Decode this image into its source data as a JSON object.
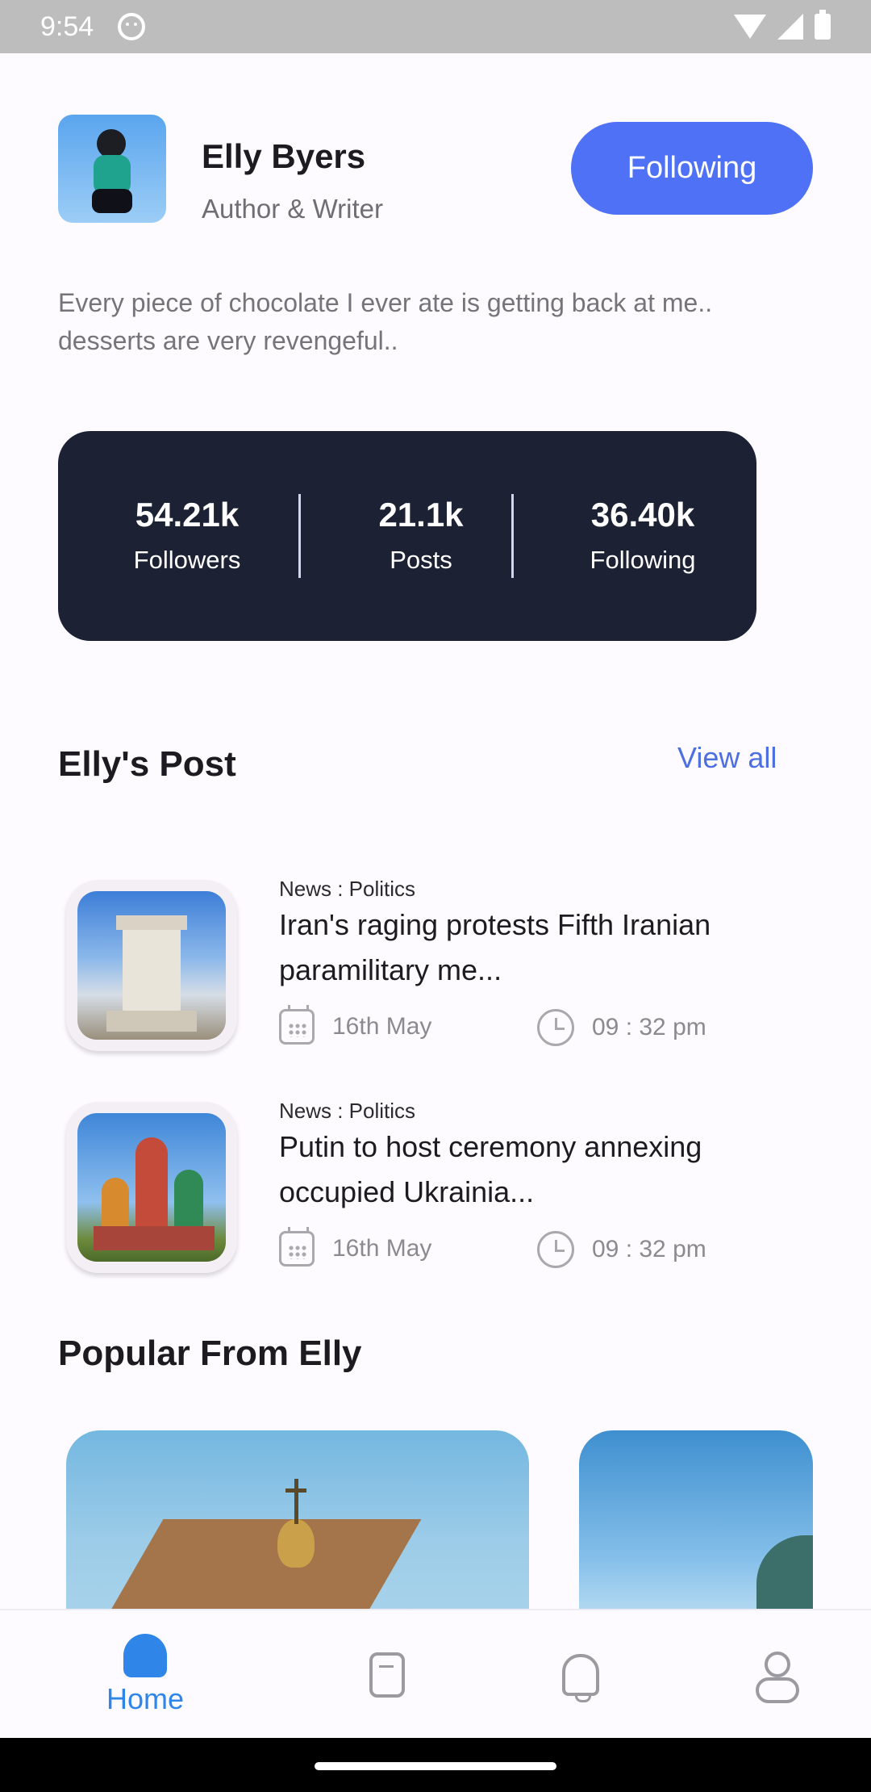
{
  "status_bar": {
    "time": "9:54"
  },
  "profile": {
    "name": "Elly Byers",
    "role": "Author & Writer",
    "follow_label": "Following",
    "bio": "Every piece of chocolate I ever ate is getting back at me.. desserts are very revengeful.."
  },
  "stats": [
    {
      "value": "54.21k",
      "label": "Followers"
    },
    {
      "value": "21.1k",
      "label": "Posts"
    },
    {
      "value": "36.40k",
      "label": "Following"
    }
  ],
  "posts_section": {
    "title": "Elly's Post",
    "view_all": "View all"
  },
  "posts": [
    {
      "category": "News : Politics",
      "title": "Iran's raging protests Fifth Iranian paramilitary me...",
      "date": "16th May",
      "time": "09 : 32 pm"
    },
    {
      "category": "News : Politics",
      "title": "Putin to host ceremony annexing occupied Ukrainia...",
      "date": "16th May",
      "time": "09 : 32 pm"
    }
  ],
  "popular_section": {
    "title": "Popular From Elly"
  },
  "bottom_nav": {
    "home": "Home"
  },
  "colors": {
    "accent": "#4f71f5",
    "stats_bg": "#1c2233",
    "link": "#4d6fe0",
    "nav_active": "#2f86e8"
  }
}
